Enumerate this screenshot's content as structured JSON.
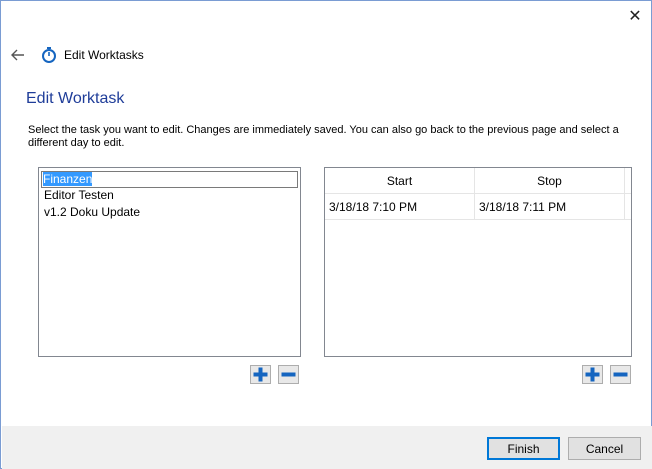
{
  "window": {
    "close_glyph": "✕"
  },
  "nav": {
    "title": "Edit Worktasks",
    "back_icon": "back-arrow-icon",
    "app_icon": "stopwatch-icon"
  },
  "page": {
    "heading": "Edit Worktask",
    "instructions": "Select the task you want to edit. Changes are immediately saved. You can also go back to the previous page and select a different day to edit."
  },
  "tasks": {
    "items": [
      "Finanzen",
      "Editor Testen",
      "v1.2 Doku Update"
    ],
    "editing_index": 0
  },
  "times": {
    "columns": [
      "Start",
      "Stop"
    ],
    "rows": [
      {
        "start": "3/18/18 7:10 PM",
        "stop": "3/18/18 7:11 PM"
      }
    ]
  },
  "buttons": {
    "finish": "Finish",
    "cancel": "Cancel"
  },
  "colors": {
    "accent": "#0078d7",
    "heading": "#1f3d99",
    "plus_blue": "#1565c0"
  }
}
